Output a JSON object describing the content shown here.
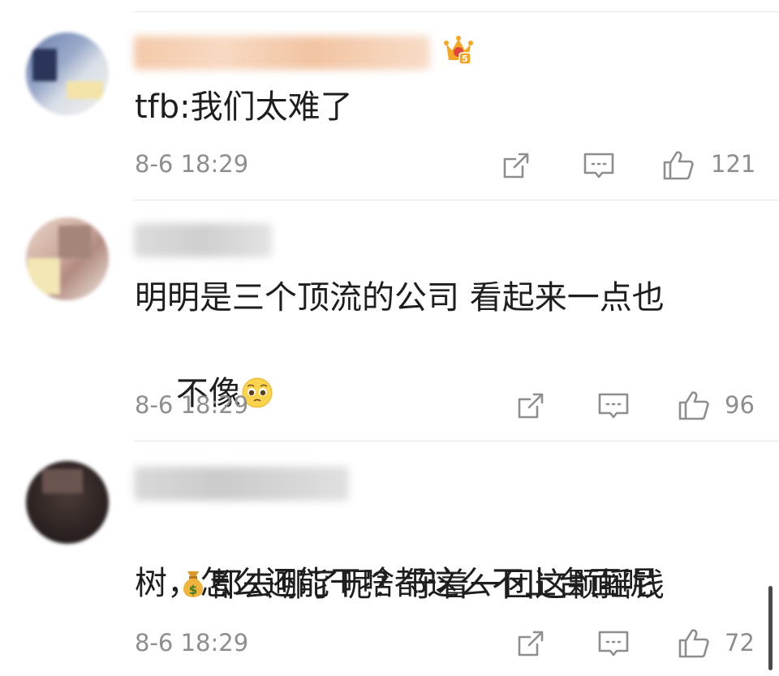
{
  "comments": [
    {
      "text": "tfb:我们太难了",
      "time": "8-6 18:29",
      "likes": "121",
      "badge_level": "5"
    },
    {
      "text_line1": "明明是三个顶流的公司 看起来一点也",
      "text_line2": "不像",
      "emoji": "pleading-face-emoji",
      "time": "8-6 18:29",
      "likes": "96"
    },
    {
      "emoji": "money-bag-emoji",
      "text_line1": "都去哪了呢？守着一团这颗摇钱",
      "text_line2": "树，怎么还能干啥都这么不上台面呢",
      "time": "8-6 18:29",
      "likes": "72"
    }
  ],
  "icons": {
    "share": "share-icon",
    "comment": "comment-icon",
    "like": "thumbs-up-icon"
  },
  "colors": {
    "background": "#ffffff",
    "text": "#1e1e1e",
    "meta": "#8e8e8e",
    "badge": "#f5a623"
  }
}
